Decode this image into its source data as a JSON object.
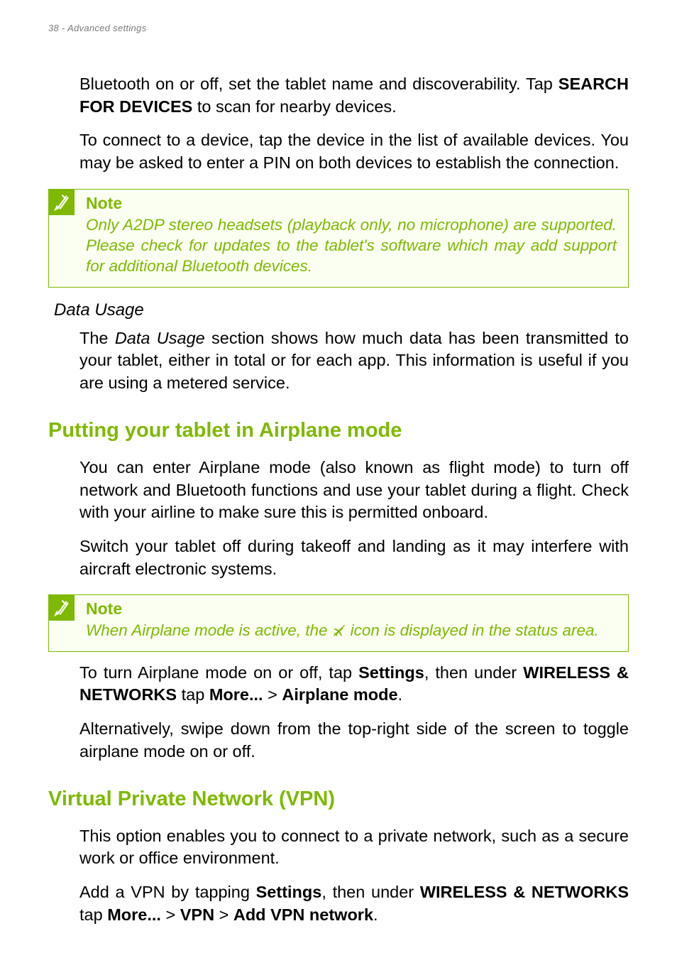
{
  "header": "38 - Advanced settings",
  "para1": {
    "text1": "Bluetooth on or off, set the tablet name and discoverability. Tap ",
    "bold1": "SEARCH FOR DEVICES",
    "text2": " to scan for nearby devices."
  },
  "para2": "To connect to a device, tap the device in the list of available devices. You may be asked to enter a PIN on both devices to establish the connection.",
  "note1": {
    "title": "Note",
    "text": "Only A2DP stereo headsets (playback only, no microphone) are supported. Please check for updates to the tablet's software which may add support for additional Bluetooth devices."
  },
  "sub1": "Data Usage",
  "para3": {
    "text1": "The ",
    "italic1": "Data Usage",
    "text2": " section shows how much data has been transmitted to your tablet, either in total or for each app. This information is useful if you are using a metered service."
  },
  "h2a": "Putting your tablet in Airplane mode",
  "para4": "You can enter Airplane mode (also known as flight mode) to turn off network and Bluetooth functions and use your tablet during a flight. Check with your airline to make sure this is permitted onboard.",
  "para5": "Switch your tablet off during takeoff and landing as it may interfere with aircraft electronic systems.",
  "note2": {
    "title": "Note",
    "text_before": "When Airplane mode is active, the ",
    "text_after": " icon is displayed in the status area."
  },
  "para6": {
    "t1": "To turn Airplane mode on or off, tap ",
    "b1": "Settings",
    "t2": ", then under ",
    "b2": "WIRELESS & NETWORKS",
    "t3": " tap ",
    "b3": "More...",
    "t4": " > ",
    "b4": "Airplane mode",
    "t5": "."
  },
  "para7": "Alternatively, swipe down from the top-right side of the screen to toggle airplane mode on or off.",
  "h2b": "Virtual Private Network (VPN)",
  "para8": "This option enables you to connect to a private network, such as a secure work or office environment.",
  "para9": {
    "t1": "Add a VPN by tapping ",
    "b1": "Settings",
    "t2": ", then under ",
    "b2": "WIRELESS & NETWORKS",
    "t3": " tap ",
    "b3": "More...",
    "t4": " > ",
    "b4": "VPN",
    "t5": " > ",
    "b5": "Add VPN network",
    "t6": "."
  }
}
